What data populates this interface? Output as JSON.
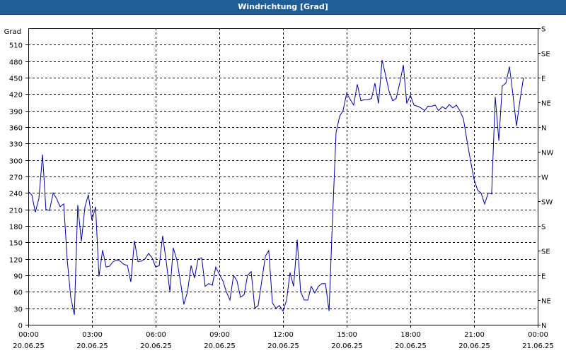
{
  "window": {
    "title": "Windrichtung [Grad]"
  },
  "colors": {
    "titlebar": "#1f5e96",
    "line": "#0000a0",
    "grid": "#000000",
    "background": "#ffffff"
  },
  "chart_data": {
    "type": "line",
    "title": "Windrichtung [Grad]",
    "ylabel": "Grad",
    "xlabel": "",
    "ylim": [
      0,
      540
    ],
    "y_ticks": [
      0,
      30,
      60,
      90,
      120,
      150,
      180,
      210,
      240,
      270,
      300,
      330,
      360,
      390,
      420,
      450,
      480,
      510
    ],
    "y2_ticks": [
      {
        "value": 0,
        "label": "N"
      },
      {
        "value": 45,
        "label": "NE"
      },
      {
        "value": 90,
        "label": "E"
      },
      {
        "value": 135,
        "label": "SE"
      },
      {
        "value": 180,
        "label": "S"
      },
      {
        "value": 225,
        "label": "SW"
      },
      {
        "value": 270,
        "label": "W"
      },
      {
        "value": 315,
        "label": "NW"
      },
      {
        "value": 360,
        "label": "N"
      },
      {
        "value": 405,
        "label": "NE"
      },
      {
        "value": 450,
        "label": "E"
      },
      {
        "value": 495,
        "label": "SE"
      },
      {
        "value": 540,
        "label": "S"
      }
    ],
    "xlim_hours": [
      0,
      24
    ],
    "x_ticks": [
      {
        "time": "00:00",
        "date": "20.06.25",
        "hour": 0
      },
      {
        "time": "03:00",
        "date": "20.06.25",
        "hour": 3
      },
      {
        "time": "06:00",
        "date": "20.06.25",
        "hour": 6
      },
      {
        "time": "09:00",
        "date": "20.06.25",
        "hour": 9
      },
      {
        "time": "12:00",
        "date": "20.06.25",
        "hour": 12
      },
      {
        "time": "15:00",
        "date": "20.06.25",
        "hour": 15
      },
      {
        "time": "18:00",
        "date": "20.06.25",
        "hour": 18
      },
      {
        "time": "21:00",
        "date": "20.06.25",
        "hour": 21
      },
      {
        "time": "00:00",
        "date": "21.06.25",
        "hour": 24
      }
    ],
    "grid": true,
    "series": [
      {
        "points": [
          [
            0.0,
            243
          ],
          [
            0.17,
            236
          ],
          [
            0.33,
            205
          ],
          [
            0.5,
            230
          ],
          [
            0.67,
            310
          ],
          [
            0.83,
            210
          ],
          [
            1.0,
            208
          ],
          [
            1.17,
            240
          ],
          [
            1.33,
            230
          ],
          [
            1.5,
            215
          ],
          [
            1.67,
            220
          ],
          [
            1.83,
            120
          ],
          [
            2.0,
            50
          ],
          [
            2.17,
            18
          ],
          [
            2.33,
            218
          ],
          [
            2.5,
            152
          ],
          [
            2.67,
            215
          ],
          [
            2.83,
            237
          ],
          [
            3.0,
            190
          ],
          [
            3.17,
            215
          ],
          [
            3.33,
            88
          ],
          [
            3.5,
            136
          ],
          [
            3.67,
            105
          ],
          [
            3.83,
            107
          ],
          [
            4.0,
            115
          ],
          [
            4.17,
            118
          ],
          [
            4.33,
            116
          ],
          [
            4.5,
            110
          ],
          [
            4.67,
            108
          ],
          [
            4.83,
            78
          ],
          [
            5.0,
            153
          ],
          [
            5.17,
            115
          ],
          [
            5.33,
            116
          ],
          [
            5.5,
            120
          ],
          [
            5.67,
            130
          ],
          [
            5.83,
            122
          ],
          [
            6.0,
            105
          ],
          [
            6.17,
            108
          ],
          [
            6.33,
            162
          ],
          [
            6.5,
            115
          ],
          [
            6.67,
            60
          ],
          [
            6.83,
            140
          ],
          [
            7.0,
            118
          ],
          [
            7.17,
            78
          ],
          [
            7.33,
            37
          ],
          [
            7.5,
            60
          ],
          [
            7.67,
            108
          ],
          [
            7.83,
            85
          ],
          [
            8.0,
            120
          ],
          [
            8.17,
            122
          ],
          [
            8.33,
            70
          ],
          [
            8.5,
            75
          ],
          [
            8.67,
            72
          ],
          [
            8.83,
            105
          ],
          [
            9.0,
            92
          ],
          [
            9.17,
            80
          ],
          [
            9.33,
            60
          ],
          [
            9.5,
            45
          ],
          [
            9.67,
            90
          ],
          [
            9.83,
            80
          ],
          [
            10.0,
            50
          ],
          [
            10.17,
            55
          ],
          [
            10.33,
            90
          ],
          [
            10.5,
            97
          ],
          [
            10.67,
            30
          ],
          [
            10.83,
            35
          ],
          [
            11.0,
            80
          ],
          [
            11.17,
            125
          ],
          [
            11.33,
            135
          ],
          [
            11.5,
            40
          ],
          [
            11.67,
            30
          ],
          [
            11.83,
            35
          ],
          [
            12.0,
            25
          ],
          [
            12.17,
            45
          ],
          [
            12.33,
            95
          ],
          [
            12.5,
            70
          ],
          [
            12.67,
            155
          ],
          [
            12.83,
            60
          ],
          [
            13.0,
            45
          ],
          [
            13.17,
            45
          ],
          [
            13.33,
            70
          ],
          [
            13.5,
            58
          ],
          [
            13.67,
            70
          ],
          [
            13.83,
            75
          ],
          [
            14.0,
            75
          ],
          [
            14.17,
            25
          ],
          [
            14.33,
            190
          ],
          [
            14.5,
            350
          ],
          [
            14.67,
            380
          ],
          [
            14.83,
            390
          ],
          [
            15.0,
            422
          ],
          [
            15.17,
            410
          ],
          [
            15.33,
            400
          ],
          [
            15.5,
            438
          ],
          [
            15.67,
            408
          ],
          [
            15.83,
            410
          ],
          [
            16.0,
            410
          ],
          [
            16.17,
            412
          ],
          [
            16.33,
            440
          ],
          [
            16.5,
            403
          ],
          [
            16.67,
            482
          ],
          [
            16.83,
            455
          ],
          [
            17.0,
            425
          ],
          [
            17.17,
            408
          ],
          [
            17.33,
            412
          ],
          [
            17.5,
            440
          ],
          [
            17.67,
            473
          ],
          [
            17.83,
            403
          ],
          [
            18.0,
            418
          ],
          [
            18.17,
            400
          ],
          [
            18.33,
            398
          ],
          [
            18.5,
            395
          ],
          [
            18.67,
            390
          ],
          [
            18.83,
            398
          ],
          [
            19.0,
            398
          ],
          [
            19.17,
            400
          ],
          [
            19.33,
            390
          ],
          [
            19.5,
            397
          ],
          [
            19.67,
            393
          ],
          [
            19.83,
            401
          ],
          [
            20.0,
            395
          ],
          [
            20.17,
            400
          ],
          [
            20.33,
            390
          ],
          [
            20.5,
            375
          ],
          [
            20.67,
            335
          ],
          [
            20.83,
            300
          ],
          [
            21.0,
            265
          ],
          [
            21.17,
            245
          ],
          [
            21.33,
            240
          ],
          [
            21.5,
            220
          ],
          [
            21.67,
            240
          ],
          [
            21.83,
            238
          ],
          [
            22.0,
            415
          ],
          [
            22.17,
            335
          ],
          [
            22.33,
            435
          ],
          [
            22.5,
            440
          ],
          [
            22.67,
            470
          ],
          [
            22.83,
            420
          ],
          [
            23.0,
            362
          ],
          [
            23.17,
            410
          ],
          [
            23.33,
            450
          ]
        ]
      }
    ]
  }
}
